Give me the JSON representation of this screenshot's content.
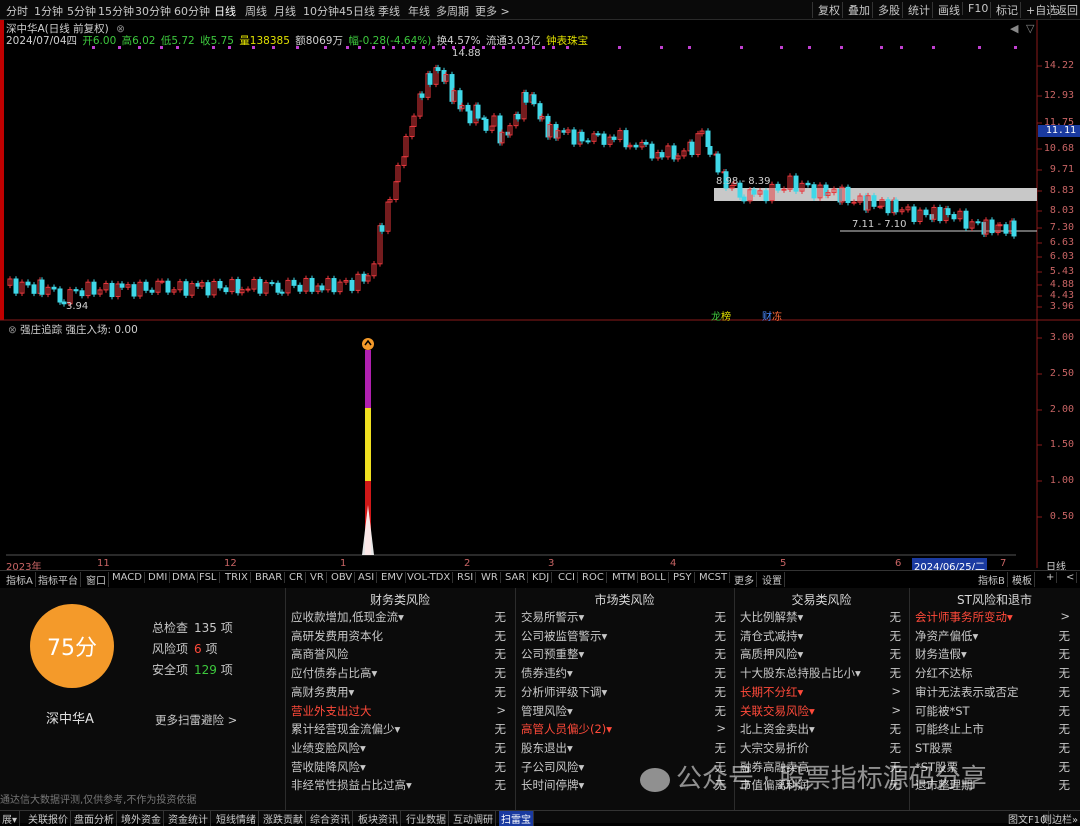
{
  "toolbar": {
    "periods": [
      "分时",
      "1分钟",
      "5分钟",
      "15分钟",
      "30分钟",
      "60分钟",
      "日线",
      "周线",
      "月线",
      "10分钟",
      "45日线",
      "季线",
      "年线",
      "多周期",
      "更多 >"
    ],
    "active_period": "日线",
    "right_buttons": [
      "复权",
      "叠加",
      "多股",
      "统计",
      "画线",
      "F10",
      "标记",
      "+自选",
      "返回"
    ]
  },
  "stock_info": {
    "title": "深中华A(日线 前复权)",
    "date": "2024/07/04四",
    "open": "开6.00",
    "high": "高6.02",
    "low": "低5.72",
    "close": "收5.75",
    "volume": "量138385",
    "amount": "额8069万",
    "change": "幅-0.28(-4.64%)",
    "turnover": "换4.57%",
    "float_cap": "流通3.03亿",
    "tool": "钟表珠宝"
  },
  "chart_annotations": {
    "high_label": "14.88",
    "low_label": "3.94",
    "range1": "8.98 - 8.39",
    "range2": "7.11 - 7.10",
    "badge1": "龙",
    "badge1b": "榜",
    "badge2": "财",
    "badge2b": "冻"
  },
  "price_axis": [
    "14.22",
    "12.93",
    "11.75",
    "10.68",
    "9.71",
    "8.83",
    "8.03",
    "7.30",
    "6.63",
    "6.03",
    "5.43",
    "4.88",
    "4.43",
    "3.96"
  ],
  "current_price": "11.11",
  "indicator": {
    "title": "强庄追踪  强庄入场: 0.00",
    "axis": [
      "3.00",
      "2.50",
      "2.00",
      "1.50",
      "1.00",
      "0.50"
    ]
  },
  "x_axis": [
    "2023年",
    "11",
    "12",
    "1",
    "2",
    "3",
    "4",
    "5",
    "6",
    "7"
  ],
  "x_axis_current": "2024/06/25/二",
  "x_axis_right": "日线",
  "indicator_tabs": [
    "指标A",
    "指标平台",
    "窗口",
    "MACD",
    "DMI",
    "DMA",
    "FSL",
    "TRIX",
    "BRAR",
    "CR",
    "VR",
    "OBV",
    "ASI",
    "EMV",
    "VOL-TDX",
    "RSI",
    "WR",
    "SAR",
    "KDJ",
    "CCI",
    "ROC",
    "MTM",
    "BOLL",
    "PSY",
    "MCST",
    "更多",
    "设置"
  ],
  "indicator_tabs_right": [
    "指标B",
    "模板",
    "+",
    "<"
  ],
  "risk": {
    "score": "75分",
    "stock_name": "深中华A",
    "more_link": "更多扫雷避险 >",
    "checks": [
      {
        "label": "总检查",
        "value": "135",
        "unit": "项",
        "color": "#c8c8c8"
      },
      {
        "label": "风险项",
        "value": "6",
        "unit": "项",
        "color": "#ff4a3a"
      },
      {
        "label": "安全项",
        "value": "129",
        "unit": "项",
        "color": "#3dc83d"
      }
    ],
    "columns": [
      {
        "header": "财务类风险",
        "rows": [
          {
            "label": "应收款增加,低现金流▾",
            "value": "无",
            "hl": false
          },
          {
            "label": "高研发费用资本化",
            "value": "无",
            "hl": false
          },
          {
            "label": "高商誉风险",
            "value": "无",
            "hl": false
          },
          {
            "label": "应付债券占比高▾",
            "value": "无",
            "hl": false
          },
          {
            "label": "高财务费用▾",
            "value": "无",
            "hl": false
          },
          {
            "label": "营业外支出过大",
            "value": ">",
            "hl": true
          },
          {
            "label": "累计经营现金流偏少▾",
            "value": "无",
            "hl": false
          },
          {
            "label": "业绩变脸风险▾",
            "value": "无",
            "hl": false
          },
          {
            "label": "营收陡降风险▾",
            "value": "无",
            "hl": false
          },
          {
            "label": "非经常性损益占比过高▾",
            "value": "无",
            "hl": false
          }
        ]
      },
      {
        "header": "市场类风险",
        "rows": [
          {
            "label": "交易所警示▾",
            "value": "无",
            "hl": false
          },
          {
            "label": "公司被监管警示▾",
            "value": "无",
            "hl": false
          },
          {
            "label": "公司预重整▾",
            "value": "无",
            "hl": false
          },
          {
            "label": "债券违约▾",
            "value": "无",
            "hl": false
          },
          {
            "label": "分析师评级下调▾",
            "value": "无",
            "hl": false
          },
          {
            "label": "管理风险▾",
            "value": "无",
            "hl": false
          },
          {
            "label": "高管人员偏少(2)▾",
            "value": ">",
            "hl": true
          },
          {
            "label": "股东退出▾",
            "value": "无",
            "hl": false
          },
          {
            "label": "子公司风险▾",
            "value": "无",
            "hl": false
          },
          {
            "label": "长时间停牌▾",
            "value": "无",
            "hl": false
          }
        ]
      },
      {
        "header": "交易类风险",
        "rows": [
          {
            "label": "大比例解禁▾",
            "value": "无",
            "hl": false
          },
          {
            "label": "清仓式减持▾",
            "value": "无",
            "hl": false
          },
          {
            "label": "高质押风险▾",
            "value": "无",
            "hl": false
          },
          {
            "label": "十大股东总持股占比小▾",
            "value": "无",
            "hl": false
          },
          {
            "label": "长期不分红▾",
            "value": ">",
            "hl": true
          },
          {
            "label": "关联交易风险▾",
            "value": ">",
            "hl": true
          },
          {
            "label": "北上资金卖出▾",
            "value": "无",
            "hl": false
          },
          {
            "label": "大宗交易折价",
            "value": "无",
            "hl": false
          },
          {
            "label": "融券高融卖高",
            "value": "无",
            "hl": false
          },
          {
            "label": "市值偏离利润",
            "value": "无",
            "hl": false
          }
        ]
      },
      {
        "header": "ST风险和退市",
        "rows": [
          {
            "label": "会计师事务所变动▾",
            "value": ">",
            "hl": true
          },
          {
            "label": "净资产偏低▾",
            "value": "无",
            "hl": false
          },
          {
            "label": "财务造假▾",
            "value": "无",
            "hl": false
          },
          {
            "label": "分红不达标",
            "value": "无",
            "hl": false
          },
          {
            "label": "审计无法表示或否定",
            "value": "无",
            "hl": false
          },
          {
            "label": "可能被*ST",
            "value": "无",
            "hl": false
          },
          {
            "label": "可能终止上市",
            "value": "无",
            "hl": false
          },
          {
            "label": "ST股票",
            "value": "无",
            "hl": false
          },
          {
            "label": "*ST股票",
            "value": "无",
            "hl": false
          },
          {
            "label": "退市整理期",
            "value": "无",
            "hl": false
          }
        ]
      }
    ],
    "watermark": "公众号 · 股票指标源码分享",
    "disclaimer": "通达信大数据评测,仅供参考,不作为投资依据"
  },
  "bottom_tabs": [
    "展▾",
    "关联报价",
    "盘面分析",
    "境外资金",
    "资金统计",
    "短线情绪",
    "涨跌贡献",
    "综合资讯",
    "板块资讯",
    "行业数据",
    "互动调研",
    "扫雷宝"
  ],
  "bottom_tabs_right": [
    "图文F10",
    "则边栏»"
  ]
}
